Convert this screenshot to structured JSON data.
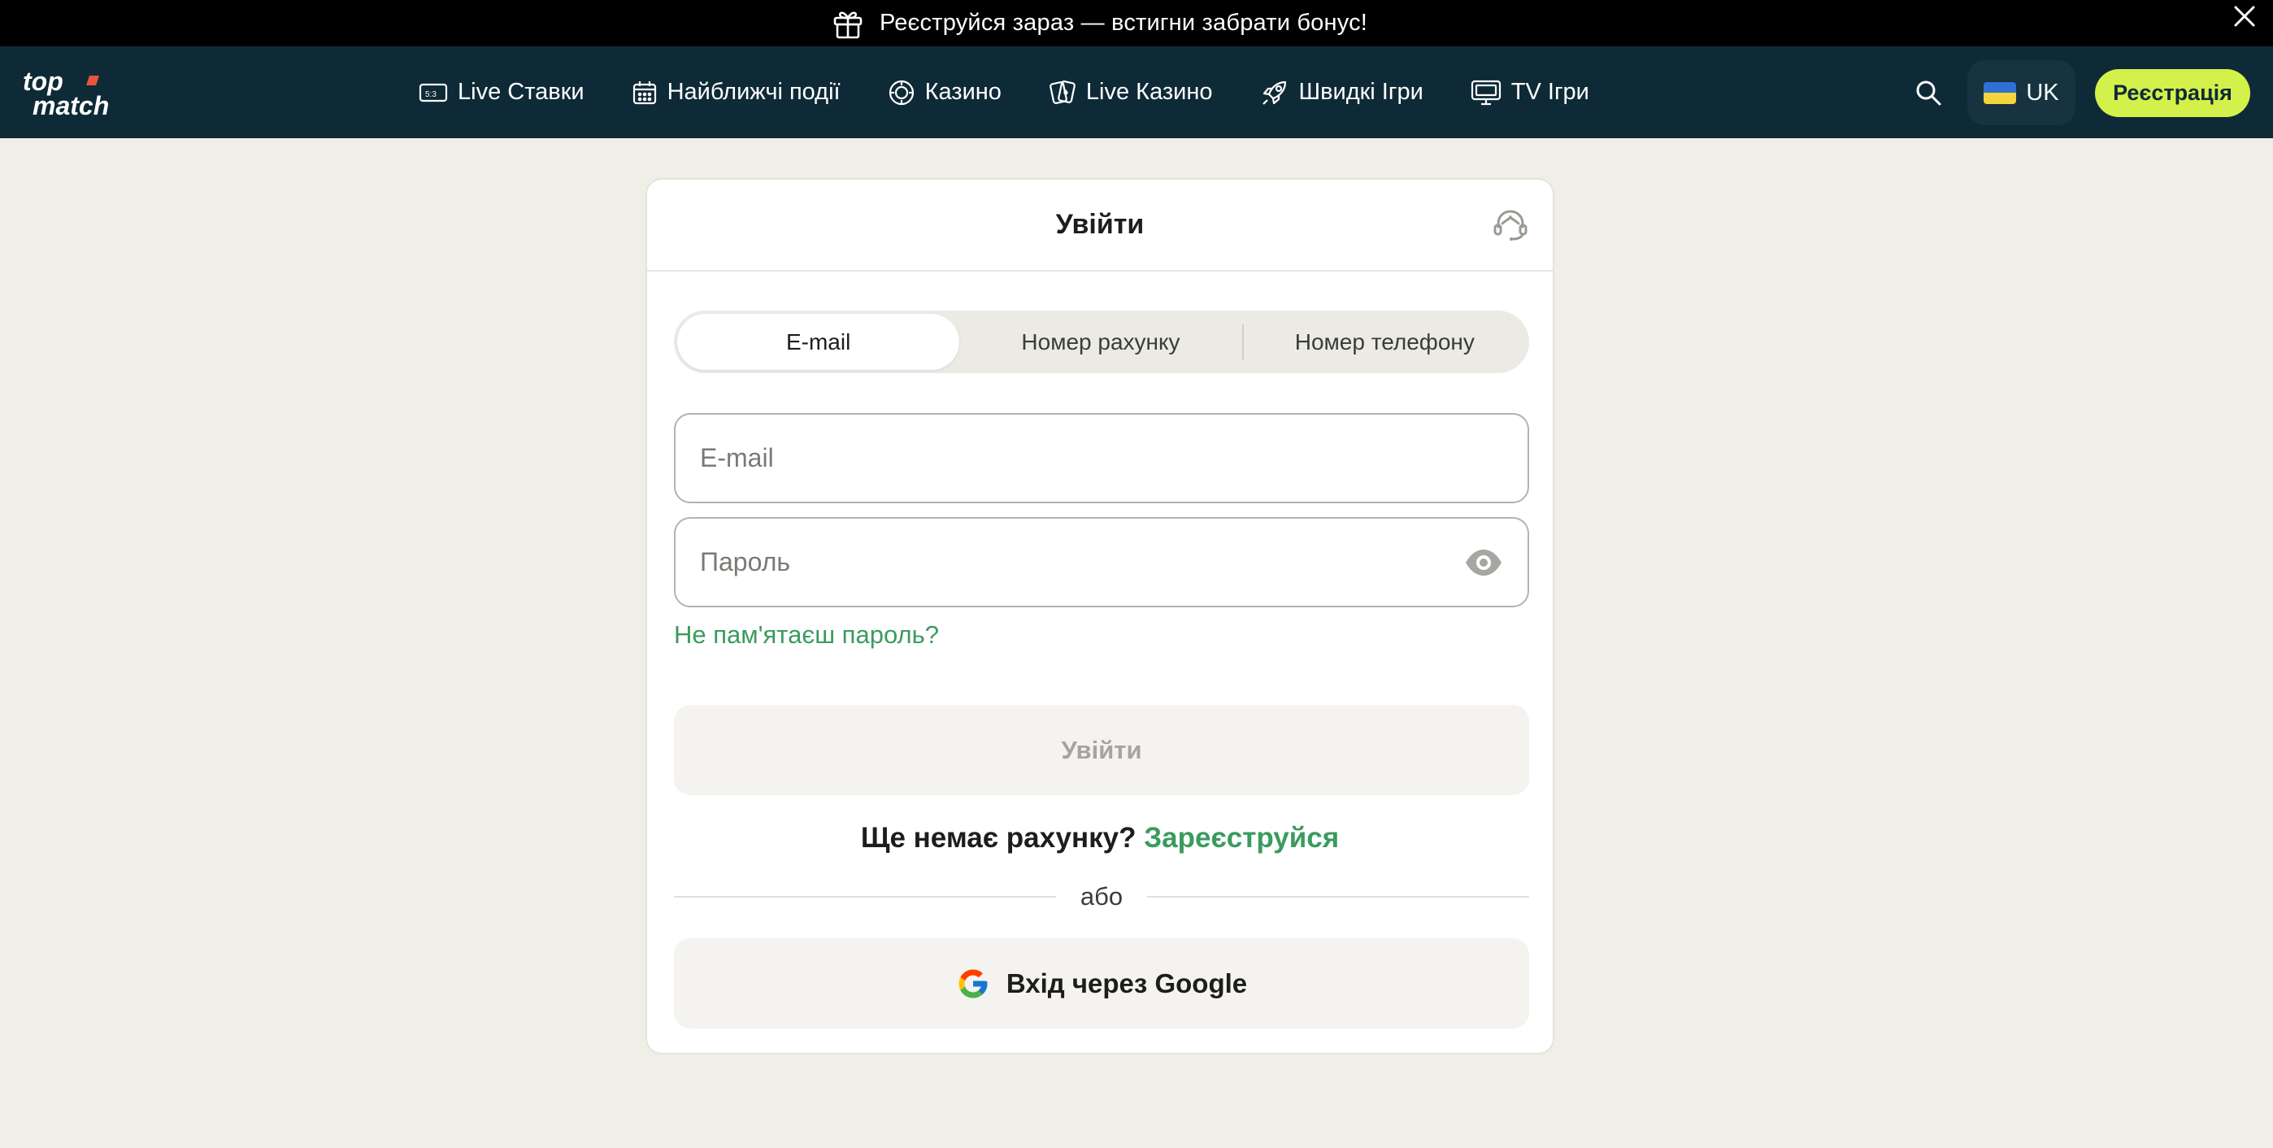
{
  "promo": {
    "text": "Реєструйся зараз — встигни забрати бонус!",
    "icon": "gift-icon",
    "close_icon": "close-icon"
  },
  "header": {
    "logo_top": "top",
    "logo_bottom": "match",
    "nav": [
      {
        "label": "Live Ставки",
        "icon": "scoreboard-icon"
      },
      {
        "label": "Найближчі події",
        "icon": "calendar-icon"
      },
      {
        "label": "Казино",
        "icon": "casino-chip-icon"
      },
      {
        "label": "Live Казино",
        "icon": "cards-icon"
      },
      {
        "label": "Швидкі Ігри",
        "icon": "rocket-icon"
      },
      {
        "label": "TV Ігри",
        "icon": "tv-icon"
      }
    ],
    "language": "UK",
    "register_label": "Реєстрація"
  },
  "login": {
    "title": "Увійти",
    "tabs": [
      {
        "label": "E-mail",
        "active": true
      },
      {
        "label": "Номер рахунку",
        "active": false
      },
      {
        "label": "Номер телефону",
        "active": false
      }
    ],
    "email_placeholder": "E-mail",
    "email_value": "",
    "password_placeholder": "Пароль",
    "password_value": "",
    "forgot_label": "Не пам'ятаєш пароль?",
    "submit_label": "Увійти",
    "no_account_text": "Ще немає рахунку?",
    "signup_link": "Зареєструйся",
    "or_text": "або",
    "google_label": "Вхід через Google"
  },
  "colors": {
    "header_bg": "#0f2a37",
    "accent_green": "#3a9b5f",
    "register_bg": "#d4f04a",
    "page_bg": "#efeee7"
  }
}
